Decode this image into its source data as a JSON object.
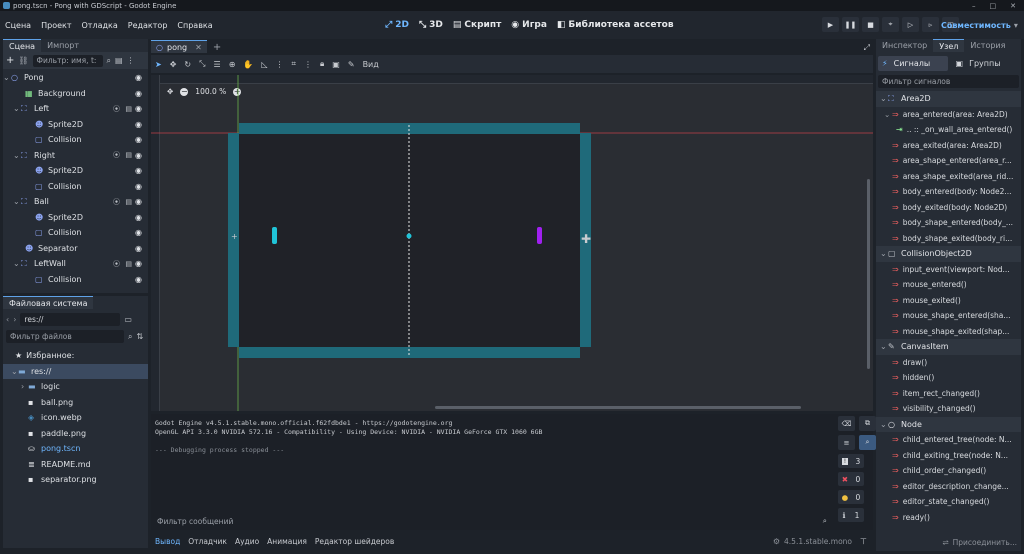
{
  "window": {
    "title": "pong.tscn - Pong with GDScript - Godot Engine",
    "minimize": "–",
    "maximize": "□",
    "close": "✕"
  },
  "menu": [
    "Сцена",
    "Проект",
    "Отладка",
    "Редактор",
    "Справка"
  ],
  "main_buttons": [
    {
      "label": "2D",
      "icon": "2d-icon",
      "active": true
    },
    {
      "label": "3D",
      "icon": "3d-icon"
    },
    {
      "label": "Скрипт",
      "icon": "script-icon"
    },
    {
      "label": "Игра",
      "icon": "game-icon"
    },
    {
      "label": "Библиотека ассетов",
      "icon": "asset-library-icon"
    }
  ],
  "run": {
    "compat": "Совместимость"
  },
  "scene_dock": {
    "tabs": [
      "Сцена",
      "Импорт"
    ],
    "filter_placeholder": "Фильтр: имя, t:",
    "nodes": [
      {
        "name": "Pong",
        "icon": "node2d-icon",
        "depth": 0,
        "expand": "v"
      },
      {
        "name": "Background",
        "icon": "texture-rect-icon",
        "depth": 1
      },
      {
        "name": "Left",
        "icon": "area2d-icon",
        "depth": 1,
        "expand": "v",
        "script": true
      },
      {
        "name": "Sprite2D",
        "icon": "sprite2d-icon",
        "depth": 2
      },
      {
        "name": "Collision",
        "icon": "collision-shape-icon",
        "depth": 2
      },
      {
        "name": "Right",
        "icon": "area2d-icon",
        "depth": 1,
        "expand": "v",
        "script": true
      },
      {
        "name": "Sprite2D",
        "icon": "sprite2d-icon",
        "depth": 2
      },
      {
        "name": "Collision",
        "icon": "collision-shape-icon",
        "depth": 2
      },
      {
        "name": "Ball",
        "icon": "area2d-icon",
        "depth": 1,
        "expand": "v",
        "script": true
      },
      {
        "name": "Sprite2D",
        "icon": "sprite2d-icon",
        "depth": 2
      },
      {
        "name": "Collision",
        "icon": "collision-shape-icon",
        "depth": 2
      },
      {
        "name": "Separator",
        "icon": "sprite2d-icon",
        "depth": 1
      },
      {
        "name": "LeftWall",
        "icon": "area2d-icon",
        "depth": 1,
        "expand": "v",
        "script": true
      },
      {
        "name": "Collision",
        "icon": "collision-shape-icon",
        "depth": 2
      }
    ]
  },
  "filesystem": {
    "tab": "Файловая система",
    "path": "res://",
    "filter_placeholder": "Фильтр файлов",
    "favorites": "Избранное:",
    "items": [
      {
        "name": "res://",
        "icon": "folder-icon",
        "depth": 0,
        "selected": true
      },
      {
        "name": "logic",
        "icon": "folder-icon",
        "depth": 1,
        "expand": "›"
      },
      {
        "name": "ball.png",
        "icon": "image-icon",
        "depth": 1
      },
      {
        "name": "icon.webp",
        "icon": "godot-icon",
        "depth": 1
      },
      {
        "name": "paddle.png",
        "icon": "image-icon",
        "depth": 1
      },
      {
        "name": "pong.tscn",
        "icon": "scene-icon",
        "depth": 1,
        "highlight": true
      },
      {
        "name": "README.md",
        "icon": "text-file-icon",
        "depth": 1
      },
      {
        "name": "separator.png",
        "icon": "image-icon",
        "depth": 1
      }
    ]
  },
  "editor": {
    "scene_tab": "pong",
    "view_menu": "Вид",
    "zoom": "100.0 %"
  },
  "output": {
    "lines": [
      "Godot Engine v4.5.1.stable.mono.official.f62fdbde1 - https://godotengine.org",
      "OpenGL API 3.3.0 NVIDIA 572.16 - Compatibility - Using Device: NVIDIA - NVIDIA GeForce GTX 1060 6GB",
      "",
      "--- Debugging process stopped ---"
    ],
    "filter_placeholder": "Фильтр сообщений",
    "counts": {
      "messages": "3",
      "errors": "0",
      "warnings": "0",
      "info": "1"
    }
  },
  "bottom_tabs": [
    "Вывод",
    "Отладчик",
    "Аудио",
    "Анимация",
    "Редактор шейдеров"
  ],
  "version": "4.5.1.stable.mono",
  "inspector": {
    "tabs": [
      "Инспектор",
      "Узел",
      "История"
    ],
    "subtabs": [
      "Сигналы",
      "Группы"
    ],
    "filter_placeholder": "Фильтр сигналов",
    "sections": [
      {
        "class": "Area2D",
        "icon": "area2d-icon",
        "signals": [
          {
            "name": "area_entered(area: Area2D)",
            "expand": "v"
          },
          {
            "name": ".. :: _on_wall_area_entered()",
            "connection": true
          },
          {
            "name": "area_exited(area: Area2D)"
          },
          {
            "name": "area_shape_entered(area_r..."
          },
          {
            "name": "area_shape_exited(area_rid..."
          },
          {
            "name": "body_entered(body: Node2..."
          },
          {
            "name": "body_exited(body: Node2D)"
          },
          {
            "name": "body_shape_entered(body_..."
          },
          {
            "name": "body_shape_exited(body_ri..."
          }
        ]
      },
      {
        "class": "CollisionObject2D",
        "icon": "collision-object-icon",
        "signals": [
          {
            "name": "input_event(viewport: Nod..."
          },
          {
            "name": "mouse_entered()"
          },
          {
            "name": "mouse_exited()"
          },
          {
            "name": "mouse_shape_entered(sha..."
          },
          {
            "name": "mouse_shape_exited(shap..."
          }
        ]
      },
      {
        "class": "CanvasItem",
        "icon": "canvas-item-icon",
        "signals": [
          {
            "name": "draw()"
          },
          {
            "name": "hidden()"
          },
          {
            "name": "item_rect_changed()"
          },
          {
            "name": "visibility_changed()"
          }
        ]
      },
      {
        "class": "Node",
        "icon": "node-icon",
        "signals": [
          {
            "name": "child_entered_tree(node: N..."
          },
          {
            "name": "child_exiting_tree(node: N..."
          },
          {
            "name": "child_order_changed()"
          },
          {
            "name": "editor_description_change..."
          },
          {
            "name": "editor_state_changed()"
          },
          {
            "name": "ready()"
          }
        ]
      }
    ],
    "connect_button": "Присоединить..."
  },
  "colors": {
    "accent": "#6fb7ff",
    "teal": "#1f6a7a",
    "paddle": "#20c4d8",
    "ball": "#a020f0"
  }
}
